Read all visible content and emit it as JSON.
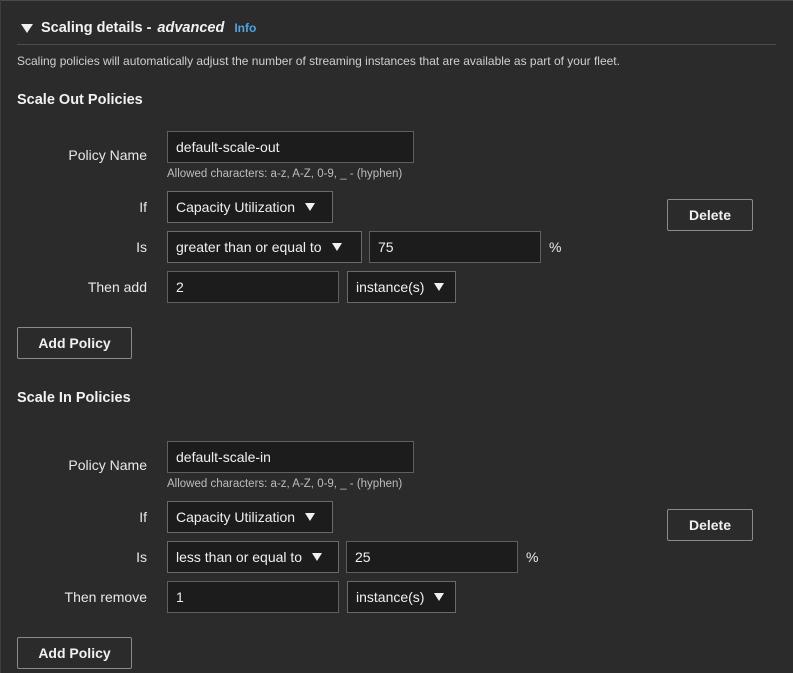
{
  "header": {
    "title": "Scaling details -",
    "advanced": "advanced",
    "info": "Info",
    "description": "Scaling policies will automatically adjust the number of streaming instances that are available as part of your fleet."
  },
  "scale_out": {
    "title": "Scale Out Policies",
    "policy_name_label": "Policy Name",
    "policy_name_value": "default-scale-out",
    "hint": "Allowed characters: a-z, A-Z, 0-9, _ - (hyphen)",
    "if_label": "If",
    "metric": "Capacity Utilization",
    "is_label": "Is",
    "comparison": "greater than or equal to",
    "threshold": "75",
    "percent": "%",
    "then_label": "Then add",
    "amount": "2",
    "unit": "instance(s)",
    "delete_label": "Delete",
    "add_label": "Add Policy"
  },
  "scale_in": {
    "title": "Scale In Policies",
    "policy_name_label": "Policy Name",
    "policy_name_value": "default-scale-in",
    "hint": "Allowed characters: a-z, A-Z, 0-9, _ - (hyphen)",
    "if_label": "If",
    "metric": "Capacity Utilization",
    "is_label": "Is",
    "comparison": "less than or equal to",
    "threshold": "25",
    "percent": "%",
    "then_label": "Then remove",
    "amount": "1",
    "unit": "instance(s)",
    "delete_label": "Delete",
    "add_label": "Add Policy"
  }
}
